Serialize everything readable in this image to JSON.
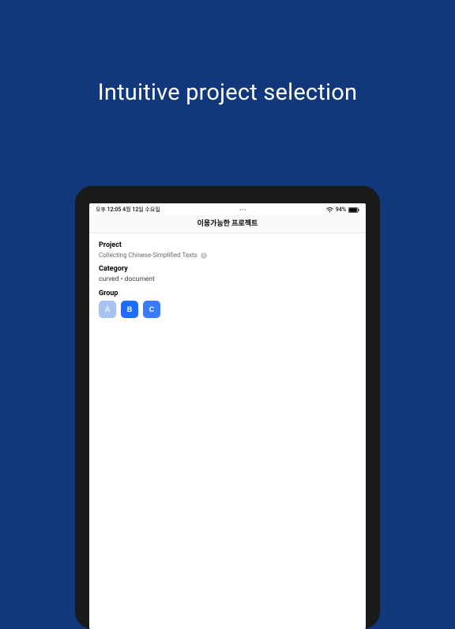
{
  "marketing": {
    "headline": "Intuitive project selection"
  },
  "statusBar": {
    "time": "오후 12:05",
    "date": "4월 12일 수요일",
    "battery": "94%"
  },
  "navBar": {
    "title": "이용가능한 프로젝트"
  },
  "sections": {
    "projectLabel": "Project",
    "projectValue": "Collecting Chinese-Simplified Texts",
    "categoryLabel": "Category",
    "categoryValue": "curved • document",
    "groupLabel": "Group"
  },
  "groups": {
    "a": "A",
    "b": "B",
    "c": "C"
  }
}
